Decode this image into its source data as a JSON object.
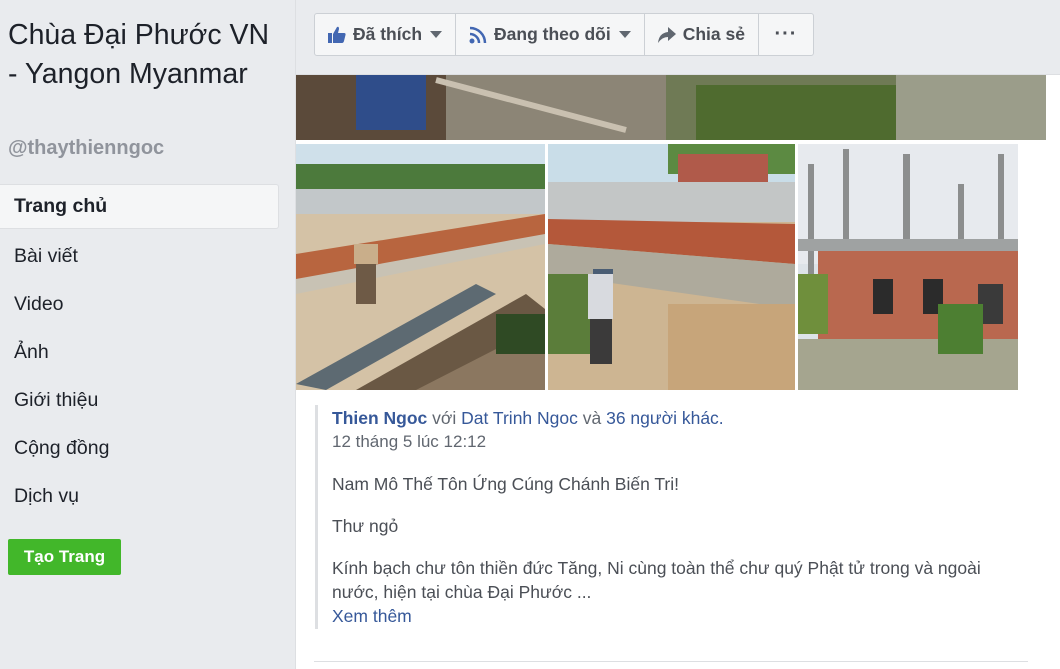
{
  "sidebar": {
    "page_name": "Chùa Đại Phước VN - Yangon Myanmar",
    "handle": "@thaythienngoc",
    "items": [
      {
        "label": "Trang chủ",
        "active": true
      },
      {
        "label": "Bài viết"
      },
      {
        "label": "Video"
      },
      {
        "label": "Ảnh"
      },
      {
        "label": "Giới thiệu"
      },
      {
        "label": "Cộng đồng"
      },
      {
        "label": "Dịch vụ"
      }
    ],
    "create_page_label": "Tạo Trang"
  },
  "actions": {
    "liked_label": "Đã thích",
    "following_label": "Đang theo dõi",
    "share_label": "Chia sẻ",
    "more_label": "···"
  },
  "post": {
    "author": "Thien Ngoc",
    "with_word": "với",
    "tagged": "Dat Trinh Ngoc",
    "and_word": "và",
    "others": "36 người khác.",
    "timestamp": "12 tháng 5 lúc 12:12",
    "paragraphs": [
      "Nam Mô Thế Tôn Ứng Cúng Chánh Biến Tri!",
      "Thư ngỏ",
      "Kính bạch chư tôn thiền đức Tăng, Ni cùng toàn thể chư quý Phật tử trong và ngoài nước, hiện tại chùa Đại Phước ..."
    ],
    "see_more": "Xem thêm"
  },
  "colors": {
    "link": "#365899",
    "accent_green": "#42b72a",
    "background": "#e9ebee"
  }
}
